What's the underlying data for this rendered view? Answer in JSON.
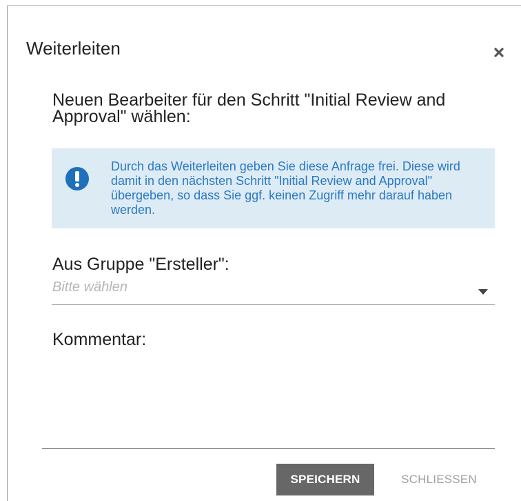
{
  "dialog": {
    "title": "Weiterleiten",
    "close_icon": "close-icon"
  },
  "prompt": {
    "text": "Neuen Bearbeiter für den Schritt \"Initial Review and Approval\" wählen:"
  },
  "alert": {
    "icon": "exclamation-circle-icon",
    "text": "Durch das Weiterleiten geben Sie diese Anfrage frei. Diese wird damit in den nächsten Schritt \"Initial Review and Approval\" übergeben, so dass Sie ggf. keinen Zugriff mehr darauf haben werden.",
    "background_color": "#ddebf5",
    "text_color": "#2b79c2"
  },
  "group_select": {
    "label": "Aus Gruppe \"Ersteller\":",
    "placeholder": "Bitte wählen",
    "caret_icon": "caret-down-icon"
  },
  "comment": {
    "label": "Kommentar:",
    "value": ""
  },
  "buttons": {
    "save_label": "SPEICHERN",
    "close_label": "SCHLIESSEN",
    "save_color": "#676767"
  }
}
